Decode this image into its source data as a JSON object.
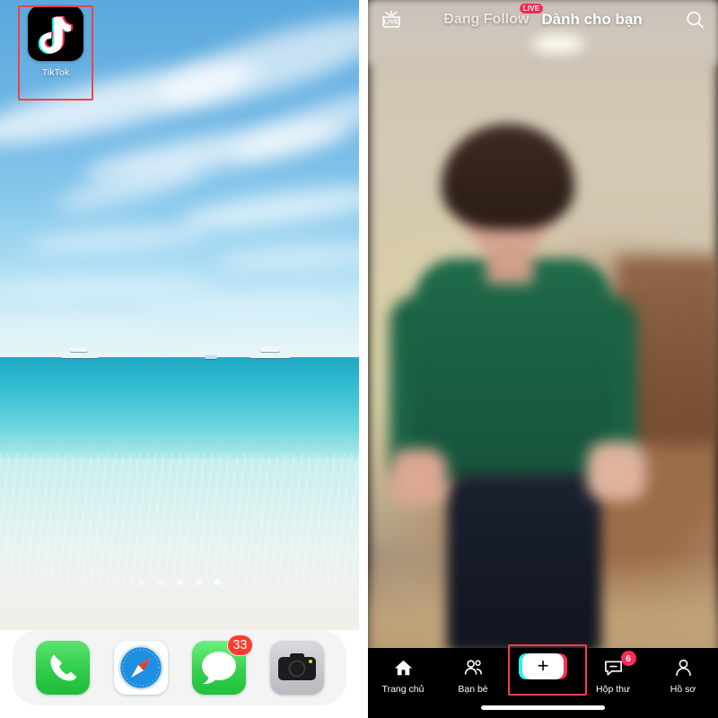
{
  "left_phone": {
    "app": {
      "name": "TikTok",
      "icon": "tiktok-icon",
      "highlighted": true,
      "highlight_color": "#f1404b"
    },
    "page_dots": {
      "count": 5,
      "active_index": 4
    },
    "dock": {
      "items": [
        {
          "name": "Phone",
          "icon": "phone-icon",
          "badge": ""
        },
        {
          "name": "Safari",
          "icon": "compass-icon",
          "badge": ""
        },
        {
          "name": "Messages",
          "icon": "message-icon",
          "badge": "33"
        },
        {
          "name": "Camera",
          "icon": "camera-icon",
          "badge": ""
        }
      ]
    },
    "wallpaper": {
      "description": "beach-wallpaper",
      "sky_color": "#6fb6e4",
      "sea_color": "#2bb6cd",
      "sand_color": "#f1efe9"
    }
  },
  "right_phone": {
    "top_bar": {
      "live_icon": "live-tv-icon",
      "tabs": [
        {
          "label": "Đang Follow",
          "active": false,
          "badge": "LIVE"
        },
        {
          "label": "Dành cho bạn",
          "active": true,
          "badge": ""
        }
      ],
      "search_icon": "search-icon"
    },
    "video": {
      "description": "blurred-person-green-shirt",
      "shirt_color": "#1a6043",
      "background_color": "#cfc4b4"
    },
    "bottom_nav": {
      "items": [
        {
          "label": "Trang chủ",
          "icon": "home-icon",
          "badge": "",
          "highlighted": false
        },
        {
          "label": "Bạn bè",
          "icon": "friends-icon",
          "badge": "",
          "highlighted": false
        },
        {
          "label": "",
          "icon": "plus-create-icon",
          "badge": "",
          "highlighted": true
        },
        {
          "label": "Hộp thư",
          "icon": "inbox-icon",
          "badge": "6",
          "highlighted": false
        },
        {
          "label": "Hồ sơ",
          "icon": "profile-icon",
          "badge": "",
          "highlighted": false
        }
      ],
      "create_button": {
        "plus": "+",
        "left_color": "#25f4ee",
        "right_color": "#fe2c55"
      },
      "highlight_color": "#f1404b",
      "accent_color": "#fe2c55"
    }
  }
}
